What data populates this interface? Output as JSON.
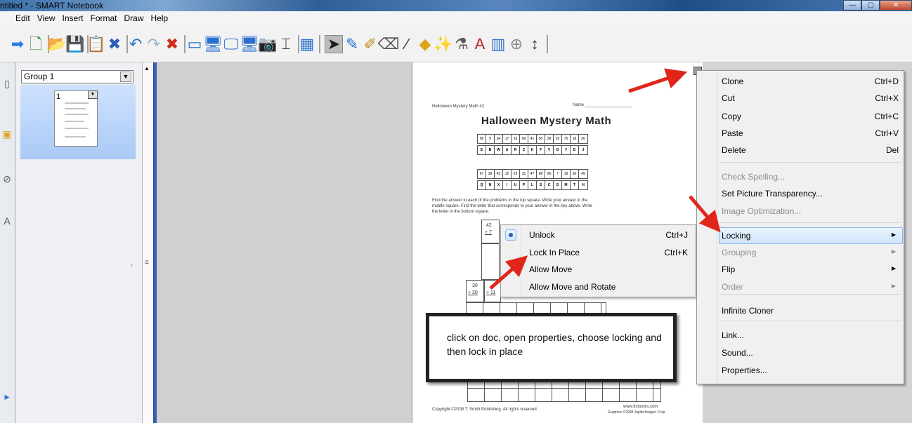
{
  "window": {
    "title": "ntitled * - SMART Notebook",
    "min_glyph": "—",
    "max_glyph": "▢",
    "close_glyph": "✕"
  },
  "menubar": [
    "Edit",
    "View",
    "Insert",
    "Format",
    "Draw",
    "Help"
  ],
  "toolbar": {
    "icons": [
      {
        "name": "next-page-icon",
        "glyph": "➡",
        "color": "#2a7be4"
      },
      {
        "name": "add-page-icon",
        "glyph": "🗋",
        "color": "#2f8a2f"
      },
      {
        "name": "open-file-icon",
        "glyph": "📂",
        "color": "#e1a21a"
      },
      {
        "name": "save-icon",
        "glyph": "💾",
        "color": "#2a5fb8"
      },
      {
        "name": "paste-icon",
        "glyph": "📋",
        "color": "#c79a2a"
      },
      {
        "name": "delete-page-icon",
        "glyph": "✖",
        "color": "#2a5fb8"
      },
      {
        "name": "undo-icon",
        "glyph": "↶",
        "color": "#2a6fd0"
      },
      {
        "name": "redo-icon",
        "glyph": "↷",
        "color": "#9ab0c8"
      },
      {
        "name": "delete-icon",
        "glyph": "✖",
        "color": "#d12a1a"
      },
      {
        "name": "screen-shade-icon",
        "glyph": "▭",
        "color": "#2a6fd0"
      },
      {
        "name": "full-screen-icon",
        "glyph": "🖥",
        "color": "#2a6fd0"
      },
      {
        "name": "transparent-bg-icon",
        "glyph": "🖵",
        "color": "#2a6fd0"
      },
      {
        "name": "dual-page-icon",
        "glyph": "🖥",
        "color": "#2a6fd0"
      },
      {
        "name": "screen-capture-icon",
        "glyph": "📷",
        "color": "#555555"
      },
      {
        "name": "document-camera-icon",
        "glyph": "⌶",
        "color": "#333333"
      },
      {
        "name": "table-icon",
        "glyph": "▦",
        "color": "#2a6fd0"
      },
      {
        "name": "select-icon",
        "glyph": "➤",
        "color": "#1a1a1a"
      },
      {
        "name": "pen-icon",
        "glyph": "✎",
        "color": "#2a6fd0"
      },
      {
        "name": "creative-pen-icon",
        "glyph": "✐",
        "color": "#c08a1a"
      },
      {
        "name": "eraser-icon",
        "glyph": "⌫",
        "color": "#555555"
      },
      {
        "name": "line-icon",
        "glyph": "∕",
        "color": "#333333"
      },
      {
        "name": "shapes-icon",
        "glyph": "◆",
        "color": "#e1a21a"
      },
      {
        "name": "magic-pen-icon",
        "glyph": "✨",
        "color": "#a050c0"
      },
      {
        "name": "fill-icon",
        "glyph": "⚗",
        "color": "#5a5a5a"
      },
      {
        "name": "text-icon",
        "glyph": "A",
        "color": "#c0202a"
      },
      {
        "name": "properties-icon",
        "glyph": "▥",
        "color": "#2a6fd0"
      },
      {
        "name": "move-toolbar-icon",
        "glyph": "⊕",
        "color": "#888888"
      },
      {
        "name": "toolbar-arrows-icon",
        "glyph": "↕",
        "color": "#333333"
      }
    ]
  },
  "sorter": {
    "group_label": "Group 1",
    "page_number": "1"
  },
  "worksheet": {
    "header_left": "Halloween Mystery Math #2",
    "header_right": "Name ____________________",
    "title": "Halloween Mystery Math",
    "grid1_nums": [
      "56",
      "9",
      "34",
      "17",
      "16",
      "99",
      "41",
      "50",
      "39",
      "26",
      "75",
      "18",
      "20"
    ],
    "grid1_letters": [
      "E",
      "B",
      "W",
      "A",
      "R",
      "Z",
      "K",
      "F",
      "V",
      "O",
      "Y",
      "D",
      "J"
    ],
    "grid2_nums": [
      "67",
      "38",
      "43",
      "12",
      "22",
      "31",
      "47",
      "86",
      "95",
      "7",
      "19",
      "30",
      "49"
    ],
    "grid2_letters": [
      "Q",
      "N",
      "X",
      "I",
      "U",
      "P",
      "L",
      "S",
      "C",
      "G",
      "M",
      "T",
      "H"
    ],
    "instructions_1": "Find the answer to each of the problems in the top square. Write your answer in the",
    "instructions_2": "middle square. Find the letter that corresponds to your answer in the key above. Write",
    "instructions_3": "the letter in the bottom square.",
    "prob1_top": "42",
    "prob1_bottom": "+ 7",
    "prob2_top": "30",
    "prob2_bottom": "+ 20",
    "prob3_bottom": "+ 11",
    "copyright": "Copyright ©2008 T. Smith Publishing.  All rights reserved.",
    "site": "www.tlsbooks.com",
    "graphics": "Graphics ©2008 JupiterImages Corp."
  },
  "context_menu": {
    "items": [
      {
        "label": "Clone",
        "shortcut": "Ctrl+D",
        "disabled": false
      },
      {
        "label": "Cut",
        "shortcut": "Ctrl+X",
        "disabled": false
      },
      {
        "label": "Copy",
        "shortcut": "Ctrl+C",
        "disabled": false
      },
      {
        "label": "Paste",
        "shortcut": "Ctrl+V",
        "disabled": false
      },
      {
        "label": "Delete",
        "shortcut": "Del",
        "disabled": false
      },
      {
        "label": "Check Spelling...",
        "shortcut": "",
        "disabled": true
      },
      {
        "label": "Set Picture Transparency...",
        "shortcut": "",
        "disabled": false
      },
      {
        "label": "Image Optimization...",
        "shortcut": "",
        "disabled": true
      },
      {
        "label": "Locking",
        "shortcut": "",
        "disabled": false,
        "submenu": true,
        "highlighted": true
      },
      {
        "label": "Grouping",
        "shortcut": "",
        "disabled": true,
        "submenu": true
      },
      {
        "label": "Flip",
        "shortcut": "",
        "disabled": false,
        "submenu": true
      },
      {
        "label": "Order",
        "shortcut": "",
        "disabled": true,
        "submenu": true
      },
      {
        "label": "Infinite Cloner",
        "shortcut": "",
        "disabled": false
      },
      {
        "label": "Link...",
        "shortcut": "",
        "disabled": false
      },
      {
        "label": "Sound...",
        "shortcut": "",
        "disabled": false
      },
      {
        "label": "Properties...",
        "shortcut": "",
        "disabled": false
      }
    ]
  },
  "submenu": {
    "items": [
      {
        "label": "Unlock",
        "shortcut": "Ctrl+J",
        "selected": true
      },
      {
        "label": "Lock In Place",
        "shortcut": "Ctrl+K",
        "selected": false
      },
      {
        "label": "Allow Move",
        "shortcut": "",
        "selected": false
      },
      {
        "label": "Allow Move and Rotate",
        "shortcut": "",
        "selected": false
      }
    ]
  },
  "callout": {
    "text": "click on doc, open properties, choose locking and then lock in place"
  },
  "colors": {
    "annotation_arrow": "#e0261b",
    "menu_highlight": "#cfe5fb"
  }
}
